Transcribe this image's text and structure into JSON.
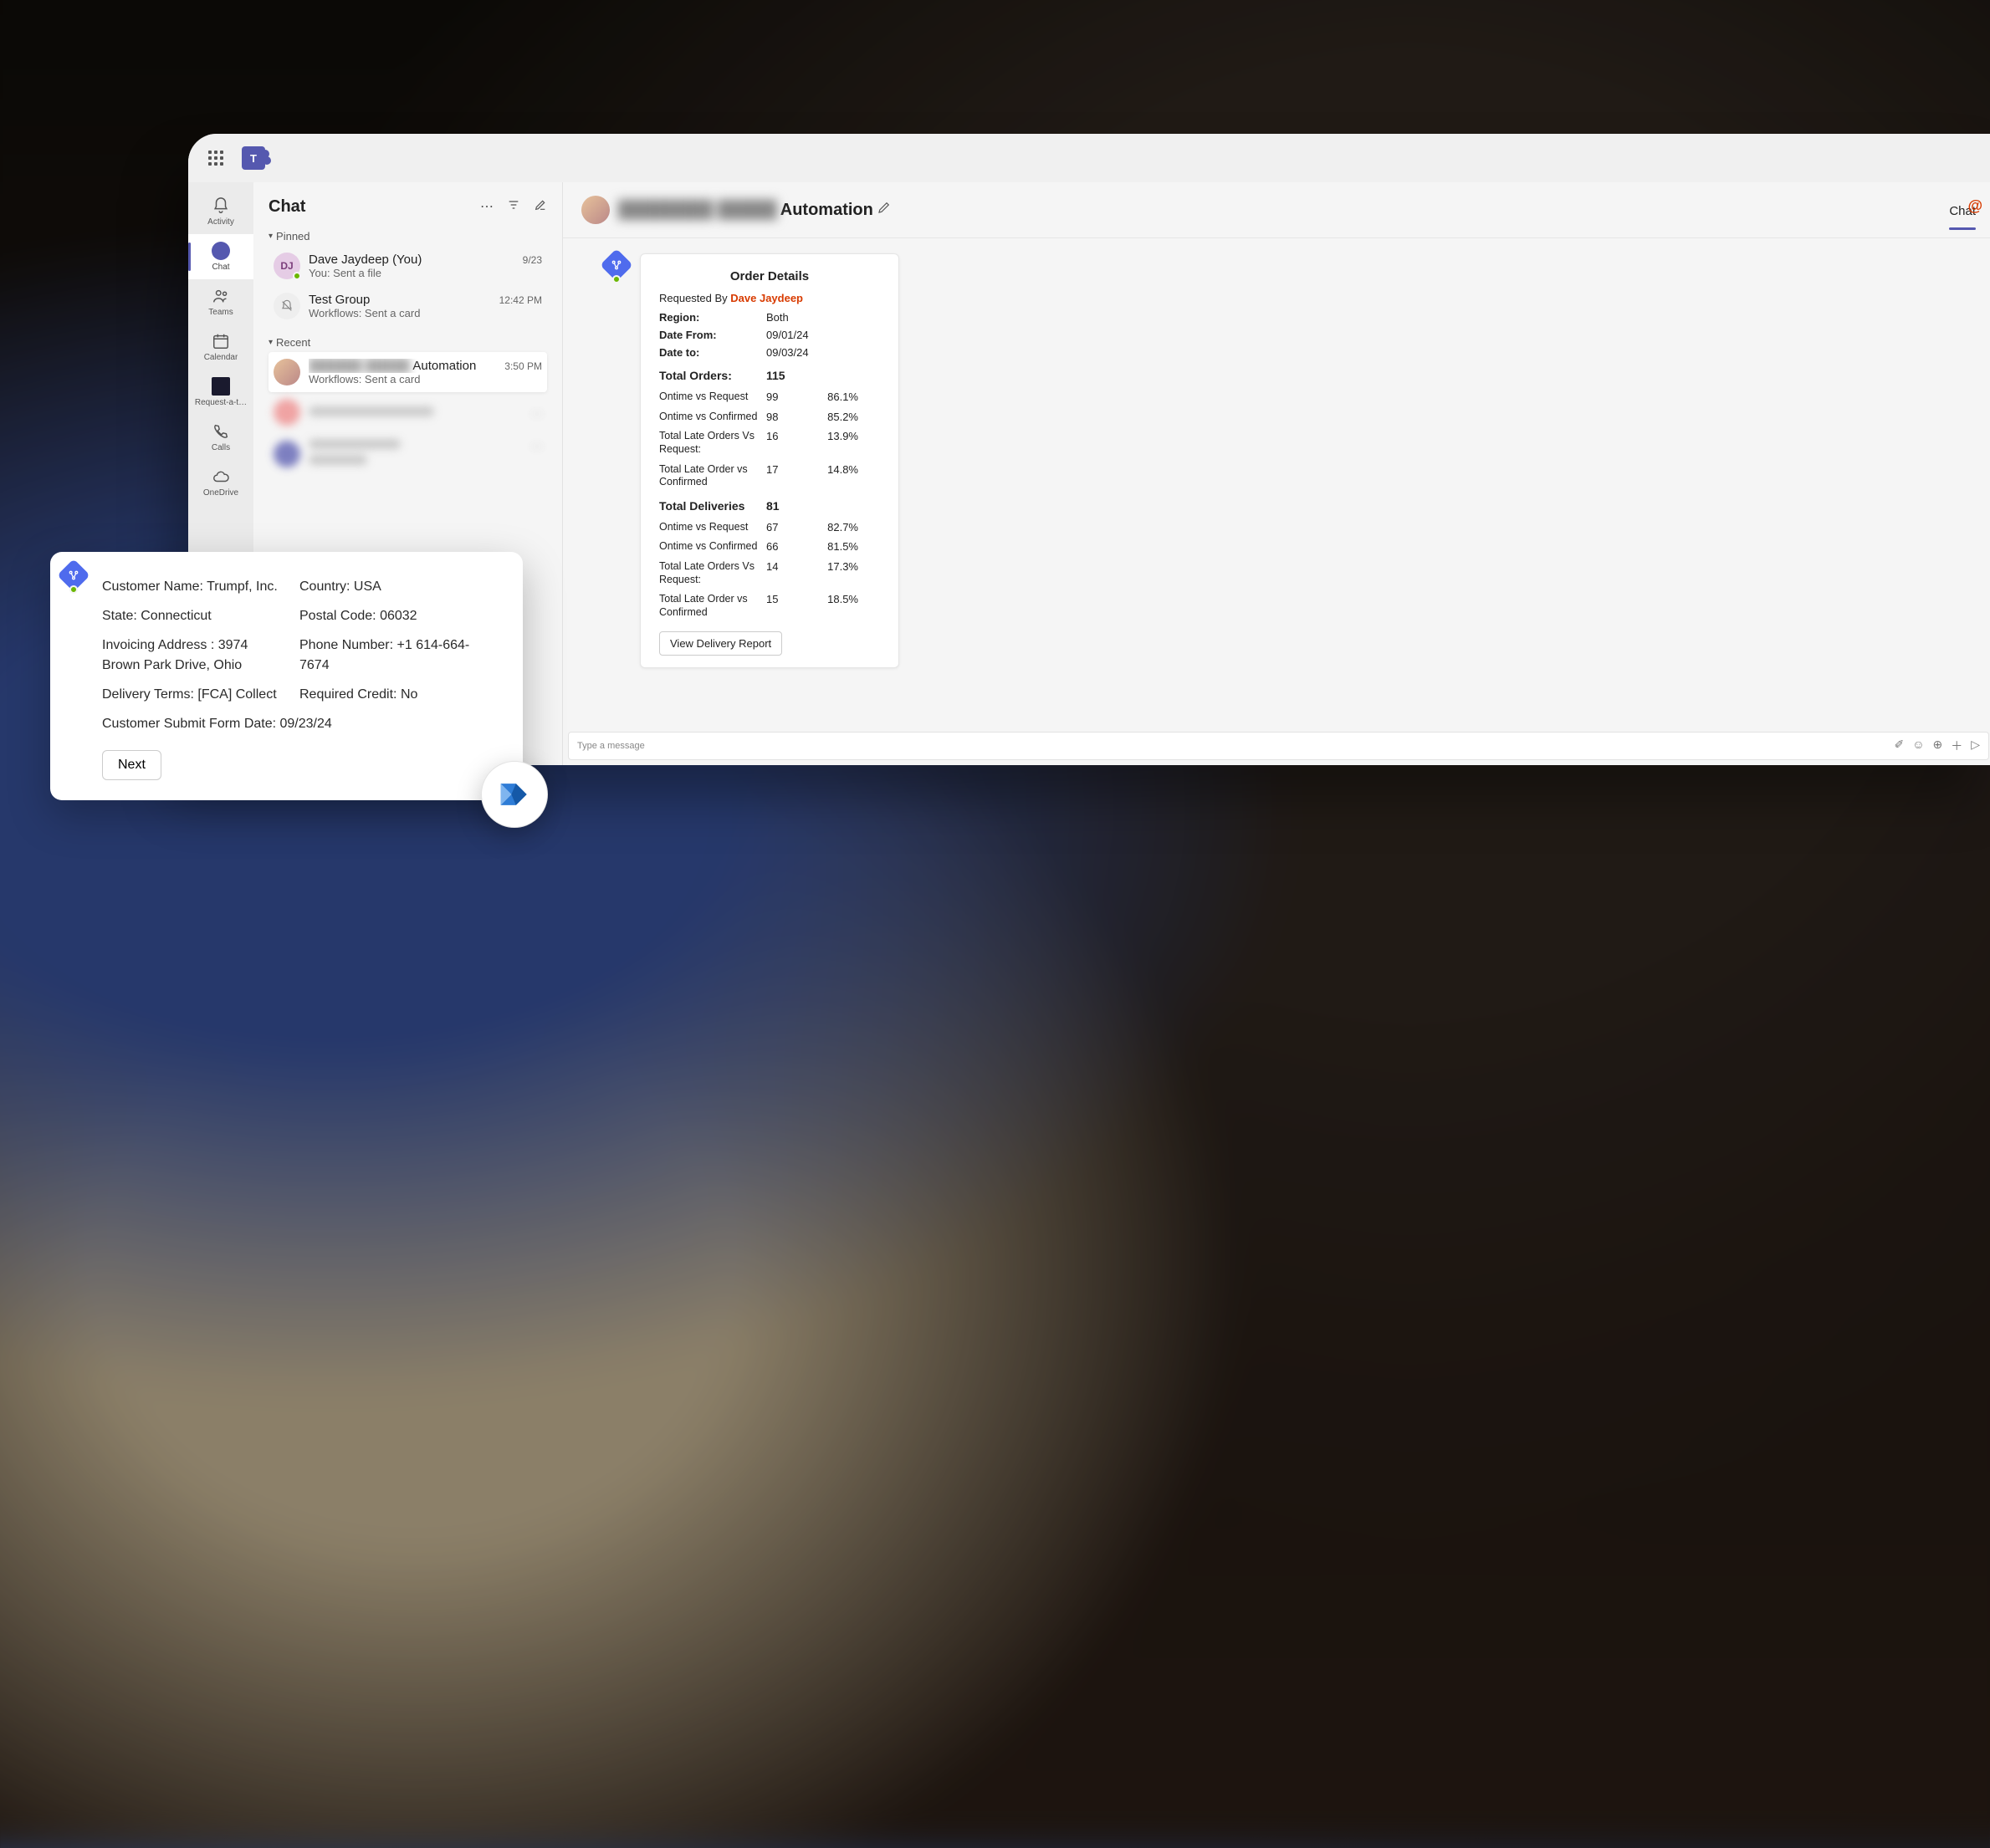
{
  "rail": {
    "activity": "Activity",
    "chat": "Chat",
    "teams": "Teams",
    "calendar": "Calendar",
    "request": "Request-a-t…",
    "calls": "Calls",
    "onedrive": "OneDrive"
  },
  "chatlist": {
    "title": "Chat",
    "sections": {
      "pinned": "Pinned",
      "recent": "Recent"
    },
    "pinned": [
      {
        "initials": "DJ",
        "name": "Dave Jaydeep (You)",
        "preview": "You: Sent a file",
        "time": "9/23"
      },
      {
        "initials": "",
        "name": "Test Group",
        "preview": "Workflows: Sent a card",
        "time": "12:42 PM"
      }
    ],
    "recent": [
      {
        "name_suffix": "Automation",
        "preview": "Workflows: Sent a card",
        "time": "3:50 PM"
      }
    ]
  },
  "convo": {
    "title_suffix": "Automation",
    "tab_chat": "Chat",
    "at": "@",
    "compose_placeholder": "Type a message"
  },
  "order_card": {
    "title": "Order Details",
    "requested_by_label": "Requested By ",
    "requested_by_name": "Dave Jaydeep",
    "region_label": "Region:",
    "region_value": "Both",
    "date_from_label": "Date From:",
    "date_from_value": "09/01/24",
    "date_to_label": "Date to:",
    "date_to_value": "09/03/24",
    "orders_title": "Total Orders:",
    "orders_total": "115",
    "o1_label": "Ontime vs Request",
    "o1_num": "99",
    "o1_pct": "86.1%",
    "o2_label": "Ontime vs Confirmed",
    "o2_num": "98",
    "o2_pct": "85.2%",
    "o3_label": "Total Late Orders Vs Request:",
    "o3_num": "16",
    "o3_pct": "13.9%",
    "o4_label": "Total Late Order vs Confirmed",
    "o4_num": "17",
    "o4_pct": "14.8%",
    "deliveries_title": "Total Deliveries",
    "deliveries_total": "81",
    "d1_label": "Ontime vs Request",
    "d1_num": "67",
    "d1_pct": "82.7%",
    "d2_label": "Ontime vs Confirmed",
    "d2_num": "66",
    "d2_pct": "81.5%",
    "d3_label": "Total Late Orders Vs Request:",
    "d3_num": "14",
    "d3_pct": "17.3%",
    "d4_label": "Total Late Order vs Confirmed",
    "d4_num": "15",
    "d4_pct": "18.5%",
    "button": "View Delivery Report"
  },
  "customer_card": {
    "name_label": "Customer Name: ",
    "name_value": "Trumpf, Inc.",
    "country_label": "Country: ",
    "country_value": "USA",
    "state_label": "State: ",
    "state_value": "Connecticut",
    "postal_label": "Postal Code: ",
    "postal_value": "06032",
    "addr_label": "Invoicing Address : ",
    "addr_value": "3974 Brown Park Drive, Ohio",
    "phone_label": "Phone Number: ",
    "phone_value": "+1 614-664-7674",
    "terms_label": "Delivery Terms: ",
    "terms_value": "[FCA] Collect",
    "credit_label": "Required Credit: ",
    "credit_value": "No",
    "submit_label": "Customer Submit Form Date: ",
    "submit_value": "09/23/24",
    "button": "Next"
  }
}
